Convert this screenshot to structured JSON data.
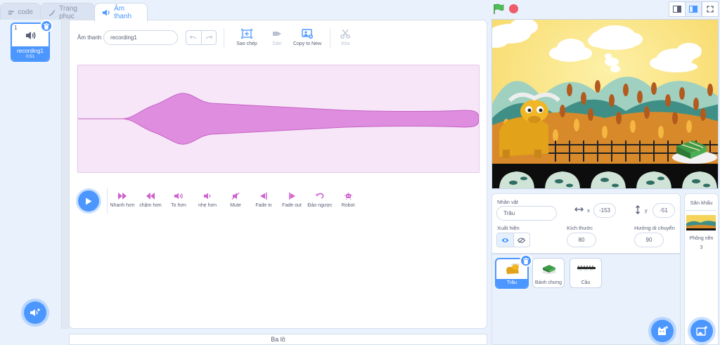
{
  "tabs": [
    {
      "label": "code",
      "icon": "code-icon"
    },
    {
      "label": "Trang phục",
      "icon": "brush-icon"
    },
    {
      "label": "Âm thanh",
      "icon": "speaker-icon"
    }
  ],
  "sound_list": {
    "items": [
      {
        "index": "1",
        "name": "recording1",
        "duration": "0.51"
      }
    ]
  },
  "editor": {
    "name_label": "Âm thanh",
    "name_value": "recording1",
    "tools": {
      "copy": "Sao chép",
      "paste": "Dán",
      "copy_new": "Copy to New",
      "delete": "Xóa"
    },
    "effects": [
      "Nhanh hơn",
      "chậm hơn",
      "To hơn",
      "nhẹ hơn",
      "Mute",
      "Fade in",
      "Fade out",
      "Đảo ngược",
      "Robot"
    ]
  },
  "backpack": {
    "label": "Ba lô"
  },
  "sprite_info": {
    "sprite_label": "Nhân vật",
    "sprite_name": "Trâu",
    "x_label": "x",
    "x_value": "-153",
    "y_label": "y",
    "y_value": "-51",
    "show_label": "Xuất hiện",
    "size_label": "Kích thước",
    "size_value": "80",
    "direction_label": "Hướng di chuyển",
    "direction_value": "90"
  },
  "sprites": [
    {
      "name": "Trâu",
      "selected": true
    },
    {
      "name": "Bánh chưng",
      "selected": false
    },
    {
      "name": "Cầu",
      "selected": false
    }
  ],
  "stage_panel": {
    "title": "Sân khấu",
    "backdrops_label": "Phông nền",
    "backdrops_count": "3"
  },
  "colors": {
    "accent": "#4c97ff",
    "sound_purple": "#cf63cf",
    "stop_red": "#ec5c6b",
    "flag_green": "#4cbf56"
  }
}
